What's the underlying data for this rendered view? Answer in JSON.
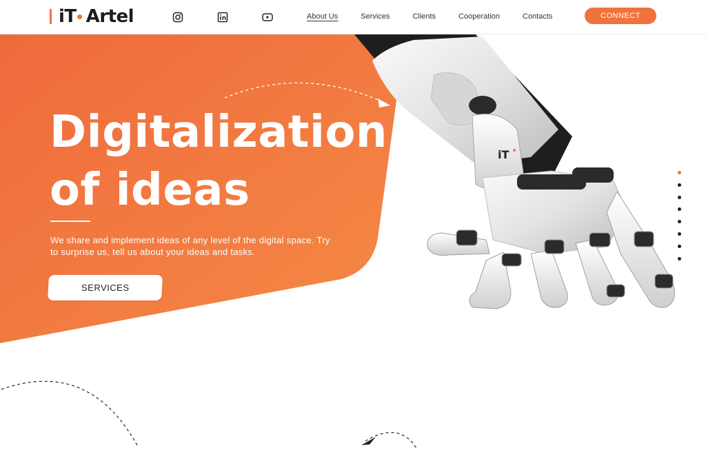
{
  "header": {
    "logo": {
      "text_left": "iT",
      "text_right": "Artel"
    },
    "social": [
      {
        "name": "instagram-icon"
      },
      {
        "name": "linkedin-icon"
      },
      {
        "name": "youtube-icon"
      }
    ],
    "nav": [
      {
        "label": "About Us",
        "active": true
      },
      {
        "label": "Services"
      },
      {
        "label": "Clients"
      },
      {
        "label": "Cooperation"
      },
      {
        "label": "Contacts"
      }
    ],
    "connect_label": "CONNECT"
  },
  "hero": {
    "title_line1": "Digitalization",
    "title_line2": "of ideas",
    "subtitle": "We share and implement ideas of any level of the digital space. Try to surprise us, tell us about your ideas and tasks.",
    "cta_label": "SERVICES",
    "robot_logo": "iT"
  },
  "slider": {
    "total": 8,
    "active_index": 0
  },
  "colors": {
    "accent": "#f0733d",
    "accent_light": "#f58a4a",
    "text_dark": "#1d1d1f"
  }
}
